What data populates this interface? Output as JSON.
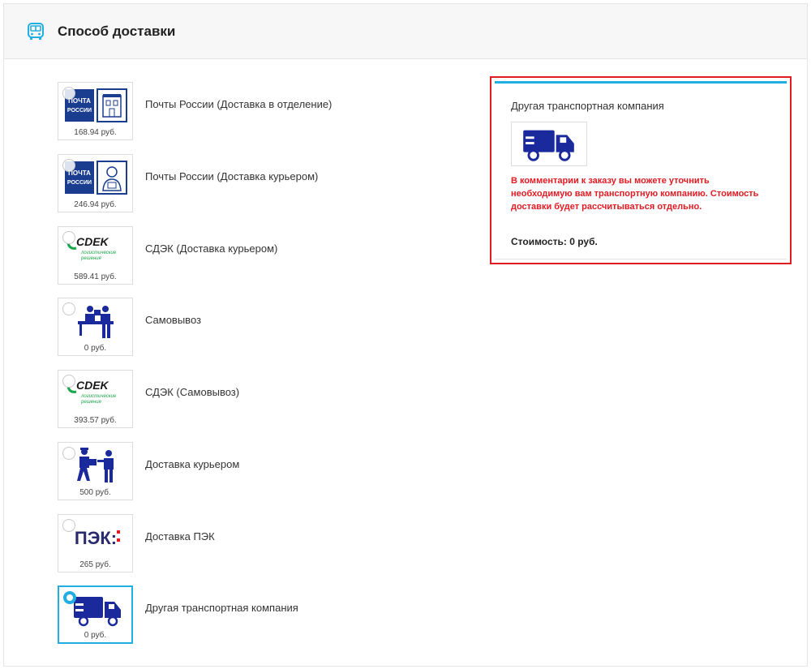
{
  "header": {
    "title": "Способ доставки",
    "icon": "bus-icon"
  },
  "colors": {
    "accent": "#22aee0",
    "alert": "#e21a22",
    "brand_blue": "#1a2a9c"
  },
  "options": [
    {
      "label": "Почты России (Доставка в отделение)",
      "price": "168.94 руб.",
      "logo_text": [
        "ПОЧТА",
        "РОССИИ"
      ],
      "icon": "russian-post-office-icon",
      "selected": false
    },
    {
      "label": "Почты России (Доставка курьером)",
      "price": "246.94 руб.",
      "logo_text": [
        "ПОЧТА",
        "РОССИИ"
      ],
      "icon": "russian-post-courier-icon",
      "selected": false
    },
    {
      "label": "СДЭК (Доставка курьером)",
      "price": "589.41 руб.",
      "logo_text": [
        "CDEK",
        "логистические",
        "решения"
      ],
      "icon": "cdek-logo",
      "selected": false
    },
    {
      "label": "Самовывоз",
      "price": "0 руб.",
      "icon": "pickup-counter-icon",
      "selected": false
    },
    {
      "label": "СДЭК (Самовывоз)",
      "price": "393.57 руб.",
      "logo_text": [
        "CDEK",
        "логистические",
        "решения"
      ],
      "icon": "cdek-logo",
      "selected": false
    },
    {
      "label": "Доставка курьером",
      "price": "500 руб.",
      "icon": "courier-handover-icon",
      "selected": false
    },
    {
      "label": "Доставка ПЭК",
      "price": "265 руб.",
      "logo_text": [
        "ПЭК:"
      ],
      "icon": "pek-logo",
      "selected": false
    },
    {
      "label": "Другая транспортная компания",
      "price": "0 руб.",
      "icon": "truck-icon",
      "selected": true
    }
  ],
  "info": {
    "title": "Другая транспортная компания",
    "icon": "truck-icon",
    "note": "В комментарии к заказу вы можете уточнить необходимую вам транспортную компанию. Стоимость доставки будет рассчитываться отдельно.",
    "cost": "Стоимость: 0 руб."
  }
}
